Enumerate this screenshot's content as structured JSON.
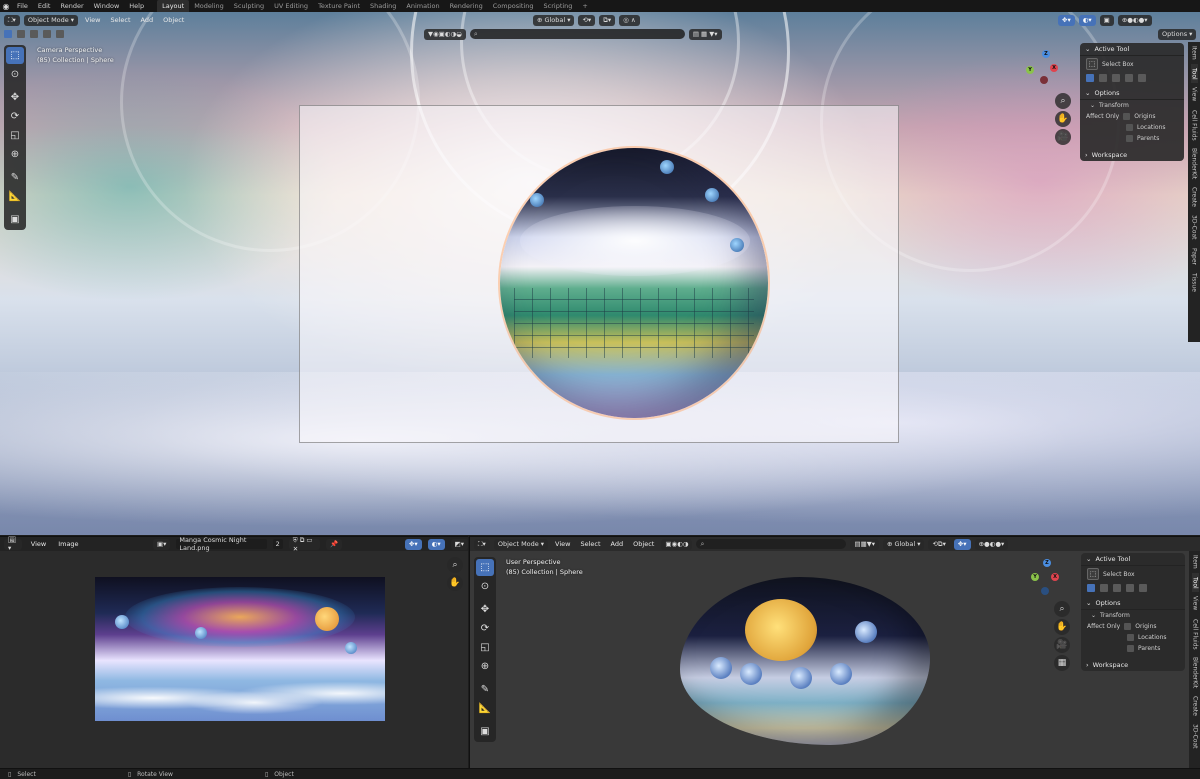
{
  "topbar": {
    "menu": [
      "File",
      "Edit",
      "Render",
      "Window",
      "Help"
    ],
    "workspaces": [
      "Layout",
      "Modeling",
      "Sculpting",
      "UV Editing",
      "Texture Paint",
      "Shading",
      "Animation",
      "Rendering",
      "Compositing",
      "Scripting"
    ],
    "active_workspace": "Layout",
    "add_tab": "+"
  },
  "viewport_top": {
    "mode": "Object Mode",
    "menu": [
      "View",
      "Select",
      "Add",
      "Object"
    ],
    "orientation": "Global",
    "options": "Options",
    "search_icon": "⌕",
    "overlay_line1": "Camera Perspective",
    "overlay_line2": "(85) Collection | Sphere"
  },
  "npanel": {
    "active_tool": "Active Tool",
    "select_box": "Select Box",
    "options": "Options",
    "transform": "Transform",
    "affect_only": "Affect Only",
    "origins": "Origins",
    "locations": "Locations",
    "parents": "Parents",
    "workspace": "Workspace"
  },
  "sidetabs": [
    "Item",
    "Tool",
    "View",
    "Cell Fluids",
    "BlenderKit",
    "Create",
    "3D-Coat",
    "Paper",
    "Tissue"
  ],
  "image_editor": {
    "menu": [
      "View",
      "Image"
    ],
    "image_name": "Manga Cosmic Night Land.png",
    "users": "2"
  },
  "viewport_bottom": {
    "mode": "Object Mode",
    "menu": [
      "View",
      "Select",
      "Add",
      "Object"
    ],
    "orientation": "Global",
    "overlay_line1": "User Perspective",
    "overlay_line2": "(85) Collection | Sphere"
  },
  "status": {
    "select": "Select",
    "rotate": "Rotate View",
    "object": "Object"
  },
  "colors": {
    "accent": "#4672b8",
    "x_axis": "#e0444e",
    "y_axis": "#8bc34a",
    "z_axis": "#4a8de0"
  }
}
